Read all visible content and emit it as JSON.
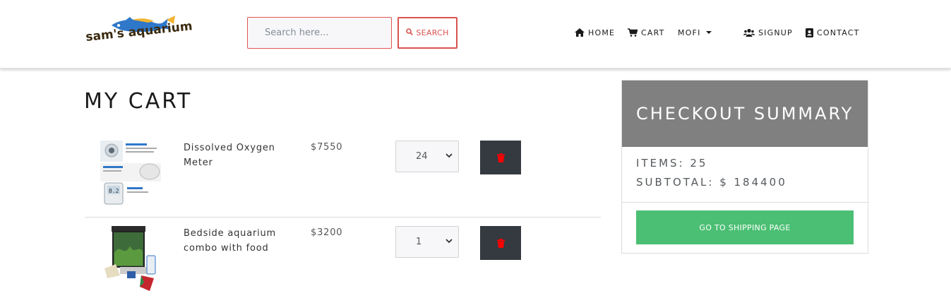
{
  "header": {
    "logo_text": "sam's aquarium",
    "search": {
      "placeholder": "Search here...",
      "value": "",
      "button_label": "SEARCH",
      "button_icon": "search-icon"
    },
    "nav": [
      {
        "label": "HOME",
        "icon": "home-icon"
      },
      {
        "label": "CART",
        "icon": "cart-icon"
      },
      {
        "label": "MOFI",
        "icon": "caret-down-icon"
      },
      {
        "label": "SIGNUP",
        "icon": "users-icon"
      },
      {
        "label": "CONTACT",
        "icon": "contact-card-icon"
      }
    ]
  },
  "cart": {
    "title": "MY CART",
    "items": [
      {
        "name": "Dissolved Oxygen Meter",
        "price": "$7550",
        "qty": "24"
      },
      {
        "name": "Bedside aquarium combo with food",
        "price": "$3200",
        "qty": "1"
      }
    ]
  },
  "summary": {
    "title": "CHECKOUT SUMMARY",
    "items": "ITEMS: 25",
    "subtotal": "SUBTOTAL: $ 184400",
    "button_label": "GO TO SHIPPING PAGE"
  },
  "colors": {
    "search_border": "#d9534f",
    "summary_header": "#808080",
    "shipping_button": "#4bbf73",
    "delete_button": "#343a40",
    "trash_icon": "#ff0000"
  }
}
